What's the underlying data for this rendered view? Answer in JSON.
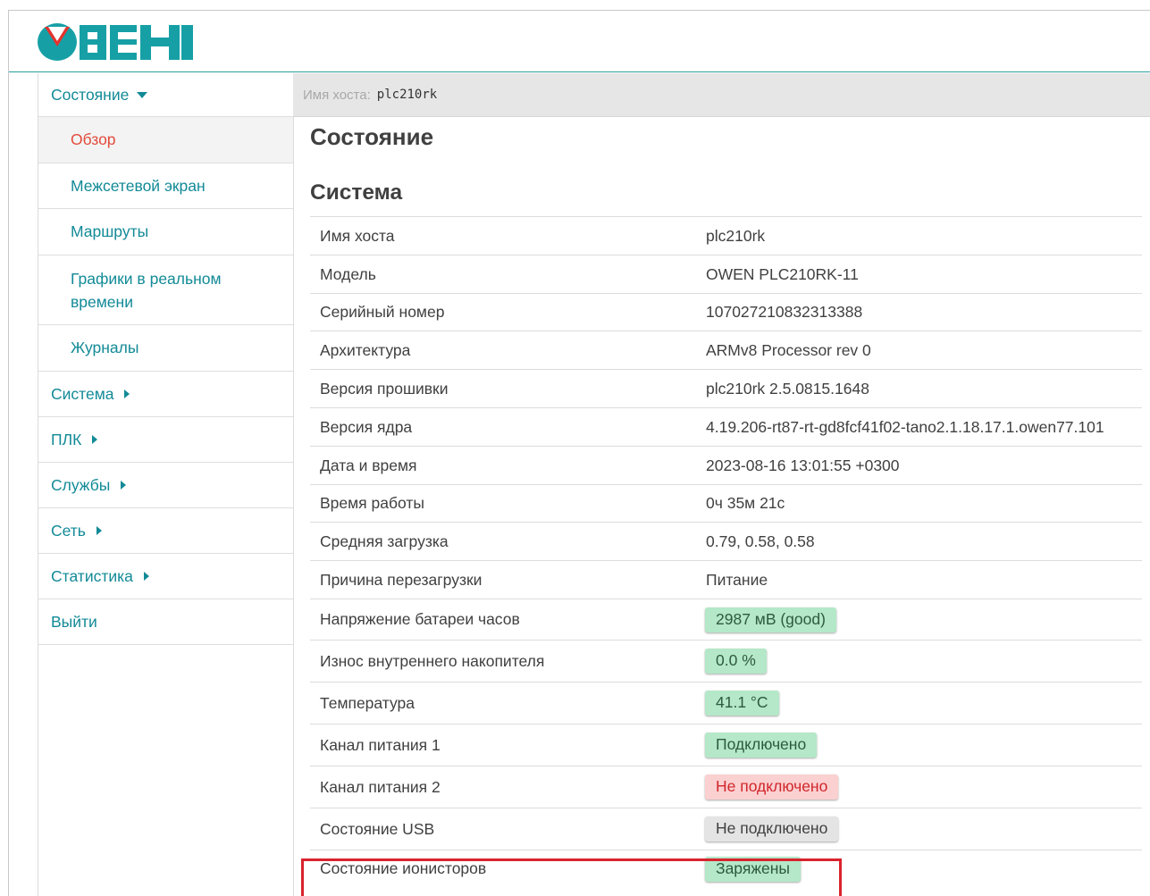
{
  "header": {
    "logo_alt": "ОВЕН"
  },
  "colors": {
    "accent": "#128a97",
    "active": "#e24b3b",
    "badge_green": "#b4e8c8",
    "badge_red": "#fbd0d0",
    "badge_gray": "#e4e4e4",
    "highlight": "#d9232d"
  },
  "sidebar": {
    "items": [
      {
        "label": "Состояние",
        "icon": "caret-down-icon"
      },
      {
        "label": "Обзор"
      },
      {
        "label": "Межсетевой экран"
      },
      {
        "label": "Маршруты"
      },
      {
        "label": "Графики в реальном времени"
      },
      {
        "label": "Журналы"
      },
      {
        "label": "Система",
        "icon": "caret-right-icon"
      },
      {
        "label": "ПЛК",
        "icon": "caret-right-icon"
      },
      {
        "label": "Службы",
        "icon": "caret-right-icon"
      },
      {
        "label": "Сеть",
        "icon": "caret-right-icon"
      },
      {
        "label": "Статистика",
        "icon": "caret-right-icon"
      },
      {
        "label": "Выйти"
      }
    ]
  },
  "hostbar": {
    "label": "Имя хоста:",
    "value": "plc210rk"
  },
  "main": {
    "title": "Состояние",
    "section": "Система",
    "rows": [
      {
        "key": "Имя хоста",
        "value": "plc210rk"
      },
      {
        "key": "Модель",
        "value": "OWEN PLC210RK-11"
      },
      {
        "key": "Серийный номер",
        "value": "107027210832313388"
      },
      {
        "key": "Архитектура",
        "value": "ARMv8 Processor rev 0"
      },
      {
        "key": "Версия прошивки",
        "value": "plc210rk 2.5.0815.1648"
      },
      {
        "key": "Версия ядра",
        "value": "4.19.206-rt87-rt-gd8fcf41f02-tano2.1.18.17.1.owen77.101"
      },
      {
        "key": "Дата и время",
        "value": "2023-08-16 13:01:55 +0300"
      },
      {
        "key": "Время работы",
        "value": "0ч 35м 21с"
      },
      {
        "key": "Средняя загрузка",
        "value": "0.79, 0.58, 0.58"
      },
      {
        "key": "Причина перезагрузки",
        "value": "Питание"
      },
      {
        "key": "Напряжение батареи часов",
        "value": "2987 мВ (good)",
        "status": "green"
      },
      {
        "key": "Износ внутреннего накопителя",
        "value": "0.0 %",
        "status": "green"
      },
      {
        "key": "Температура",
        "value": "41.1 °C",
        "status": "green"
      },
      {
        "key": "Канал питания 1",
        "value": "Подключено",
        "status": "green"
      },
      {
        "key": "Канал питания 2",
        "value": "Не подключено",
        "status": "red"
      },
      {
        "key": "Состояние USB",
        "value": "Не подключено",
        "status": "gray"
      },
      {
        "key": "Состояние ионисторов",
        "value": "Заряжены",
        "status": "green"
      }
    ]
  }
}
